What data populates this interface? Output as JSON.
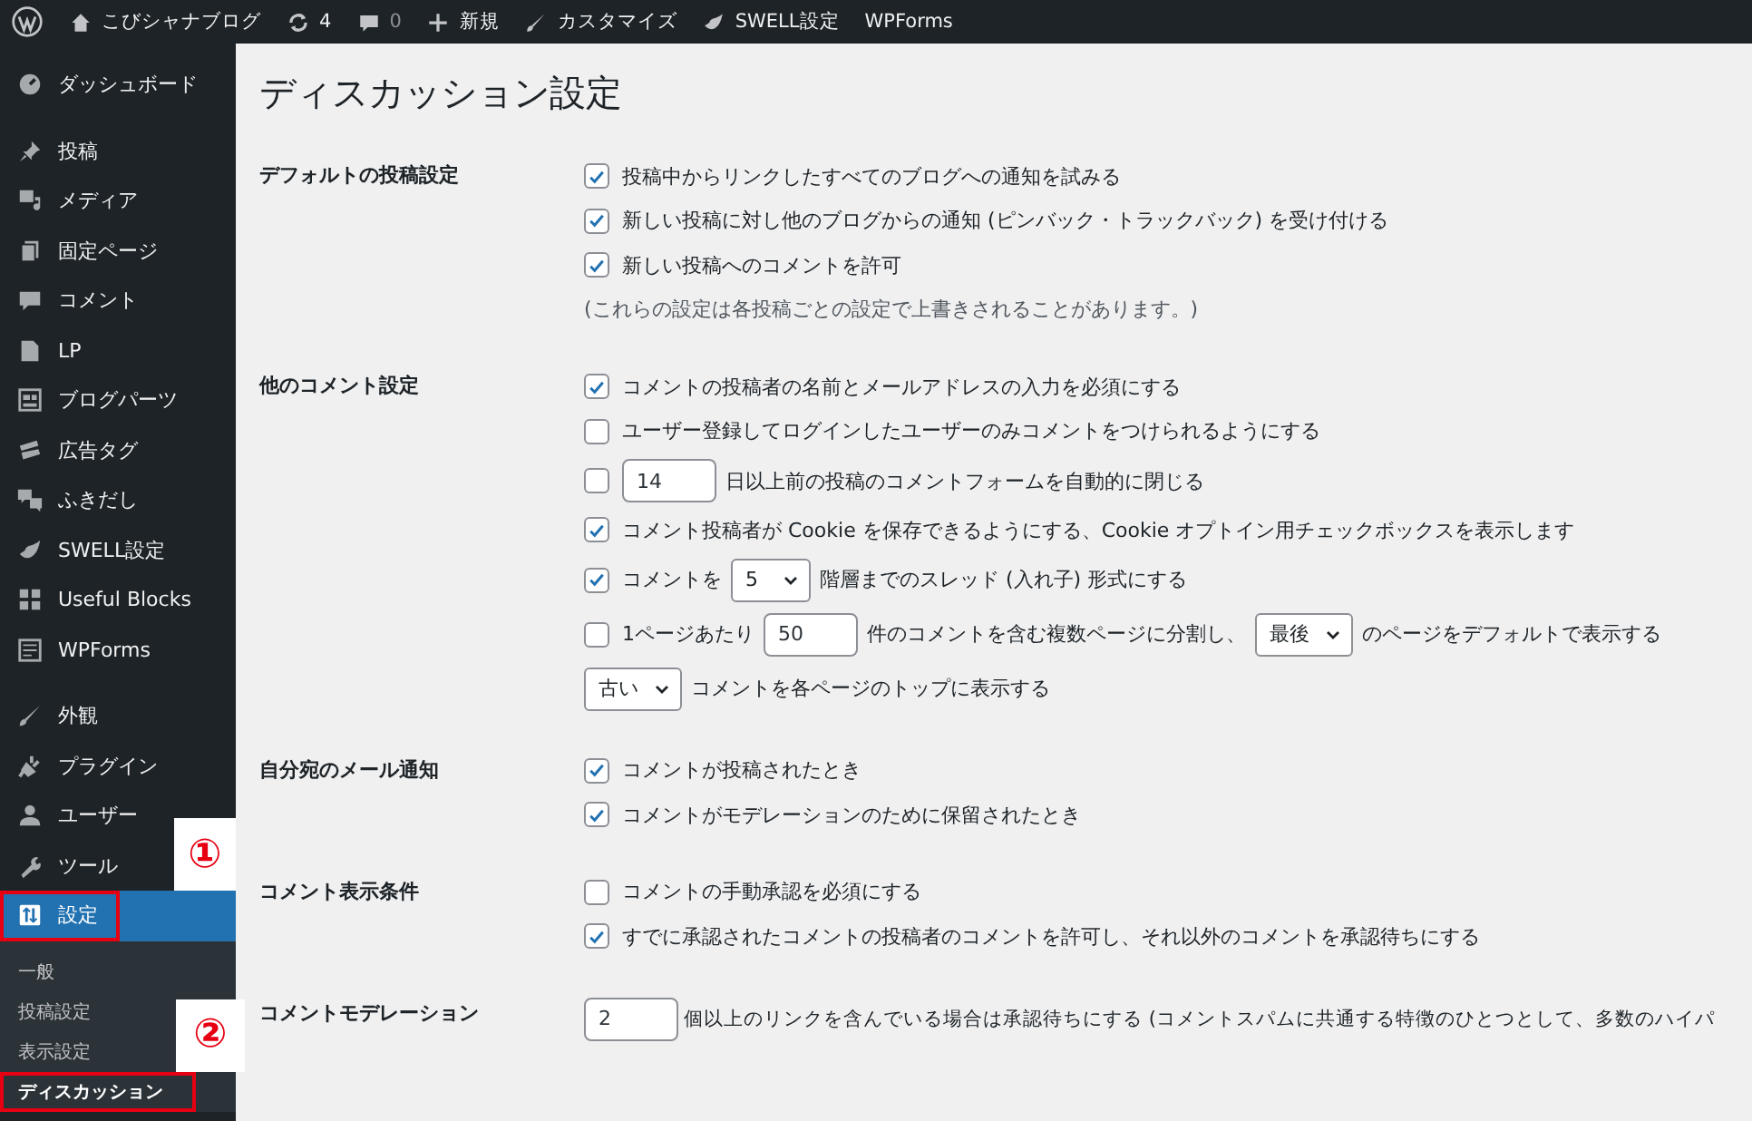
{
  "admin_bar": {
    "items": [
      {
        "text": "こびシャナブログ"
      },
      {
        "text": "4"
      },
      {
        "text": "0",
        "muted": true
      },
      {
        "text": "新規"
      },
      {
        "text": "カスタマイズ"
      },
      {
        "text": "SWELL設定"
      },
      {
        "text": "WPForms"
      }
    ]
  },
  "sidebar": {
    "groups": [
      [
        {
          "label": "ダッシュボード",
          "selected": false
        }
      ],
      [
        {
          "label": "投稿",
          "selected": false
        },
        {
          "label": "メディア",
          "selected": false
        },
        {
          "label": "固定ページ",
          "selected": false
        },
        {
          "label": "コメント",
          "selected": false
        },
        {
          "label": "LP",
          "selected": false
        },
        {
          "label": "ブログパーツ",
          "selected": false
        },
        {
          "label": "広告タグ",
          "selected": false
        },
        {
          "label": "ふきだし",
          "selected": false
        },
        {
          "label": "SWELL設定",
          "selected": false
        },
        {
          "label": "Useful Blocks",
          "selected": false
        },
        {
          "label": "WPForms",
          "selected": false
        }
      ],
      [
        {
          "label": "外観",
          "selected": false
        },
        {
          "label": "プラグイン",
          "selected": false
        },
        {
          "label": "ユーザー",
          "selected": false
        },
        {
          "label": "ツール",
          "selected": false
        },
        {
          "label": "設定",
          "selected": true,
          "annotation": "①",
          "children": [
            {
              "label": "一般",
              "selected": false
            },
            {
              "label": "投稿設定",
              "selected": false
            },
            {
              "label": "表示設定",
              "selected": false
            },
            {
              "label": "ディスカッション",
              "selected": true,
              "annotation": "②"
            }
          ]
        }
      ]
    ]
  },
  "page_title": "ディスカッション設定",
  "sections": [
    {
      "label": "デフォルトの投稿設定",
      "lines": [
        [
          {
            "kind": "checkbox",
            "checked": true
          },
          {
            "kind": "text",
            "text": "投稿中からリンクしたすべてのブログへの通知を試みる"
          }
        ],
        [
          {
            "kind": "checkbox",
            "checked": true
          },
          {
            "kind": "text",
            "text": "新しい投稿に対し他のブログからの通知 (ピンバック・トラックバック) を受け付ける"
          }
        ],
        [
          {
            "kind": "checkbox",
            "checked": true
          },
          {
            "kind": "text",
            "text": "新しい投稿へのコメントを許可"
          }
        ],
        [
          {
            "kind": "note",
            "text": "(これらの設定は各投稿ごとの設定で上書きされることがあります。)"
          }
        ]
      ]
    },
    {
      "label": "他のコメント設定",
      "lines": [
        [
          {
            "kind": "checkbox",
            "checked": true
          },
          {
            "kind": "text",
            "text": "コメントの投稿者の名前とメールアドレスの入力を必須にする"
          }
        ],
        [
          {
            "kind": "checkbox",
            "checked": false
          },
          {
            "kind": "text",
            "text": "ユーザー登録してログインしたユーザーのみコメントをつけられるようにする"
          }
        ],
        [
          {
            "kind": "checkbox",
            "checked": false
          },
          {
            "kind": "input",
            "value": "14"
          },
          {
            "kind": "text",
            "text": "日以上前の投稿のコメントフォームを自動的に閉じる"
          }
        ],
        [
          {
            "kind": "checkbox",
            "checked": true
          },
          {
            "kind": "text",
            "text": "コメント投稿者が Cookie を保存できるようにする、Cookie オプトイン用チェックボックスを表示します"
          }
        ],
        [
          {
            "kind": "checkbox",
            "checked": true
          },
          {
            "kind": "text",
            "text": "コメントを"
          },
          {
            "kind": "select",
            "value": "5"
          },
          {
            "kind": "text",
            "text": "階層までのスレッド (入れ子) 形式にする"
          }
        ],
        [
          {
            "kind": "checkbox",
            "checked": false
          },
          {
            "kind": "text",
            "text": "1ページあたり"
          },
          {
            "kind": "input",
            "value": "50"
          },
          {
            "kind": "text",
            "text": "件のコメントを含む複数ページに分割し、"
          },
          {
            "kind": "select",
            "value": "最後"
          },
          {
            "kind": "text",
            "text": "のページをデフォルトで表示する"
          }
        ],
        [
          {
            "kind": "select",
            "value": "古い"
          },
          {
            "kind": "text",
            "text": "コメントを各ページのトップに表示する"
          }
        ]
      ]
    },
    {
      "label": "自分宛のメール通知",
      "lines": [
        [
          {
            "kind": "checkbox",
            "checked": true
          },
          {
            "kind": "text",
            "text": "コメントが投稿されたとき"
          }
        ],
        [
          {
            "kind": "checkbox",
            "checked": true
          },
          {
            "kind": "text",
            "text": "コメントがモデレーションのために保留されたとき"
          }
        ]
      ]
    },
    {
      "label": "コメント表示条件",
      "lines": [
        [
          {
            "kind": "checkbox",
            "checked": false
          },
          {
            "kind": "text",
            "text": "コメントの手動承認を必須にする"
          }
        ],
        [
          {
            "kind": "checkbox",
            "checked": true
          },
          {
            "kind": "text",
            "text": "すでに承認されたコメントの投稿者のコメントを許可し、それ以外のコメントを承認待ちにする"
          }
        ]
      ]
    },
    {
      "label": "コメントモデレーション",
      "lines": [
        [
          {
            "kind": "input",
            "value": "2"
          },
          {
            "kind": "text",
            "text": "個以上のリンクを含んでいる場合は承認待ちにする (コメントスパムに共通する特徴のひとつとして、多数のハイパ"
          }
        ]
      ]
    }
  ]
}
